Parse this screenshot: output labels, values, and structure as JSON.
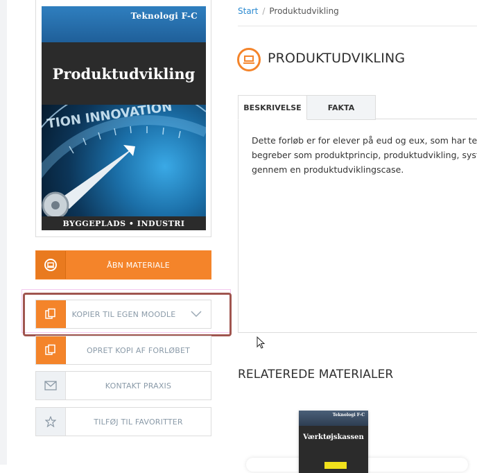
{
  "cover": {
    "series": "Teknologi F-C",
    "title": "Produktudvikling",
    "footer": "BYGGEPLADS • INDUSTRI"
  },
  "actions": [
    {
      "label": "ÅBN MATERIALE",
      "icon": "open-material-icon",
      "style": "orange"
    },
    {
      "label": "KOPIER TIL EGEN MOODLE",
      "icon": "copy-icon",
      "style": "dropdown"
    },
    {
      "label": "OPRET KOPI AF FORLØBET",
      "icon": "copy-icon",
      "style": "plain"
    },
    {
      "label": "KONTAKT PRAXIS",
      "icon": "envelope-icon",
      "style": "plain"
    },
    {
      "label": "TILFØJ TIL FAVORITTER",
      "icon": "star-icon",
      "style": "plain"
    }
  ],
  "breadcrumb": {
    "home": "Start",
    "separator": "/",
    "current": "Produktudvikling"
  },
  "page": {
    "title": "PRODUKTUDVIKLING",
    "tabs": [
      "BESKRIVELSE",
      "FAKTA"
    ],
    "active_tab": "BESKRIVELSE",
    "description": [
      "Dette forløb er for elever på eud og eux, som har tekn",
      "begreber som produktprincip, produktudvikling, syste",
      "gennem en produktudviklingscase."
    ]
  },
  "related": {
    "title": "RELATEREDE MATERIALER",
    "items": [
      {
        "series": "Teknologi F-C",
        "title": "Værktøjskassen"
      }
    ]
  },
  "colors": {
    "accent": "#f4842a",
    "link": "#2b8ad1",
    "highlight": "#a0554f"
  }
}
